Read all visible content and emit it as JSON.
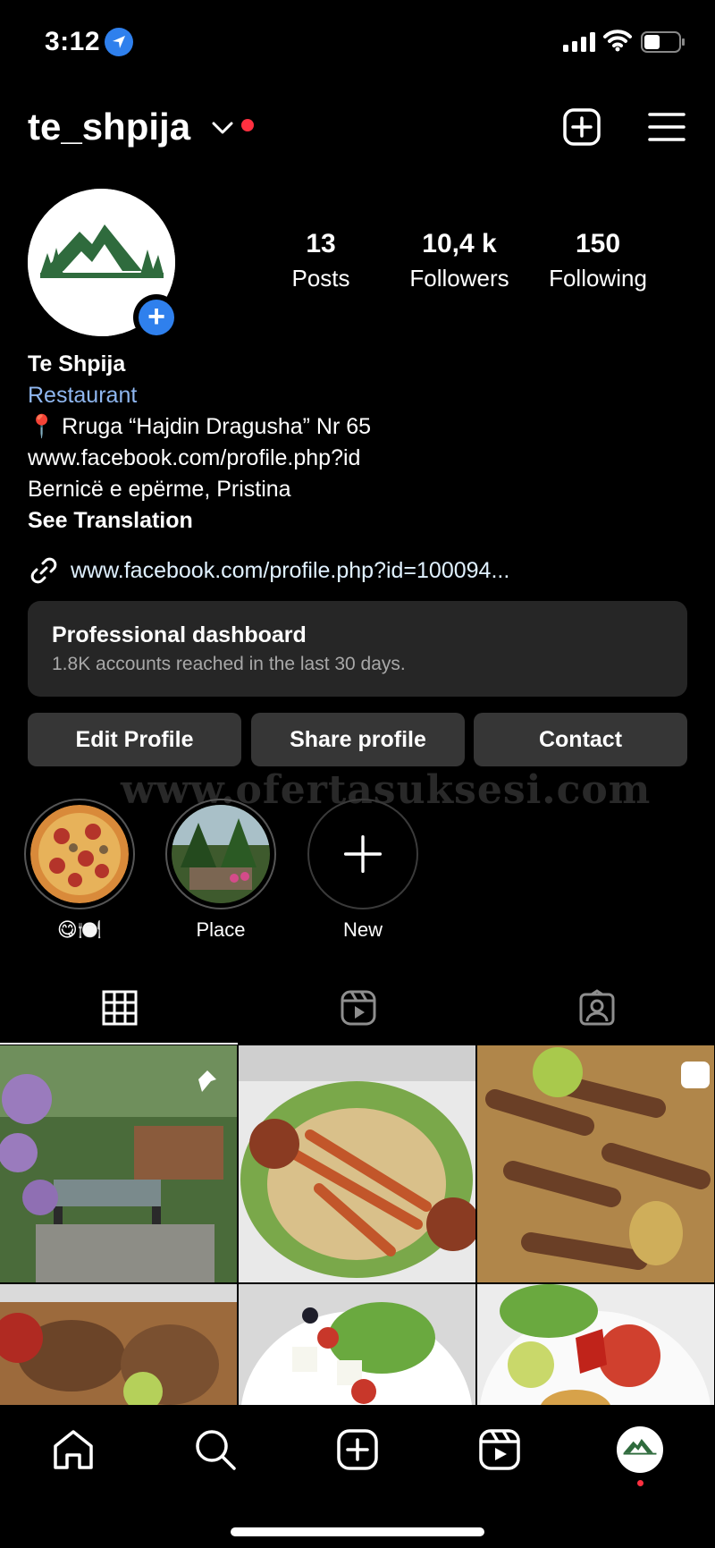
{
  "status_bar": {
    "time": "3:12"
  },
  "header": {
    "username": "te_shpija"
  },
  "profile": {
    "stats": [
      {
        "value": "13",
        "label": "Posts"
      },
      {
        "value": "10,4 k",
        "label": "Followers"
      },
      {
        "value": "150",
        "label": "Following"
      }
    ],
    "name": "Te Shpija",
    "category": "Restaurant",
    "bio_lines": [
      "📍 Rruga “Hajdin Dragusha” Nr 65",
      "www.facebook.com/profile.php?id",
      "Bernicë e epërme, Pristina"
    ],
    "see_translation": "See Translation",
    "link": "www.facebook.com/profile.php?id=100094..."
  },
  "dashboard": {
    "title": "Professional dashboard",
    "subtitle": "1.8K accounts reached in the last 30 days."
  },
  "buttons": {
    "edit": "Edit Profile",
    "share": "Share profile",
    "contact": "Contact"
  },
  "watermark": "www.ofertasuksesi.com",
  "highlights": [
    {
      "label": "😋🍽️"
    },
    {
      "label": "Place"
    },
    {
      "label": "New"
    }
  ],
  "colors": {
    "accent": "#2f80ed",
    "notification": "#ff3040",
    "button_bg": "#363636",
    "card_bg": "#262626"
  }
}
